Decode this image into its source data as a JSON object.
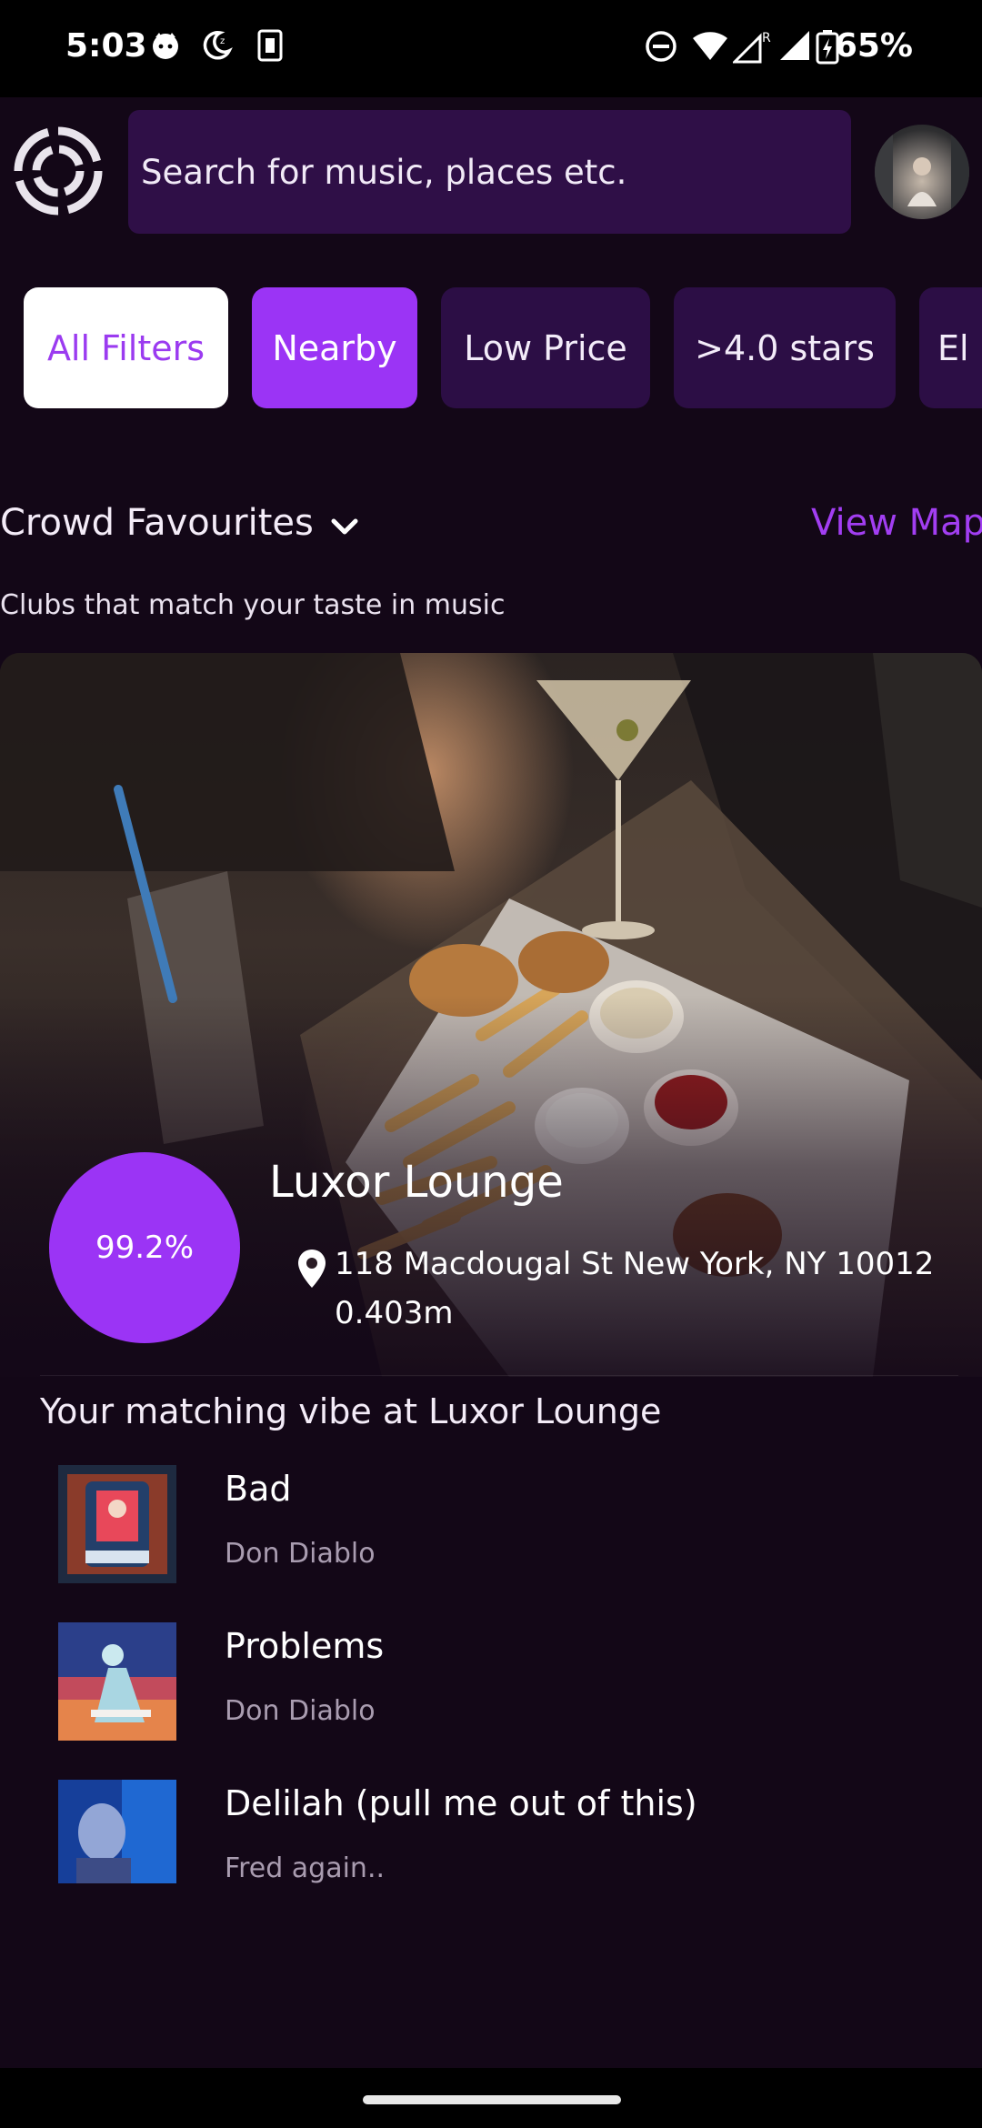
{
  "status_bar": {
    "time": "5:03",
    "battery": "65%",
    "icons": [
      "github-icon",
      "night-mode-icon",
      "sim-card-icon",
      "dnd-icon",
      "wifi-icon",
      "signal-roaming-icon",
      "signal-icon",
      "battery-charging-icon"
    ]
  },
  "header": {
    "logo_icon": "app-logo-icon",
    "search_placeholder": "Search for music, places etc.",
    "avatar_icon": "profile-avatar"
  },
  "filters": [
    {
      "label": "All Filters",
      "state": "outlined"
    },
    {
      "label": "Nearby",
      "state": "active"
    },
    {
      "label": "Low Price",
      "state": "inactive"
    },
    {
      "label": ">4.0 stars",
      "state": "inactive"
    },
    {
      "label": "El",
      "state": "inactive"
    }
  ],
  "section": {
    "title": "Crowd Favourites",
    "view_map": "View Map",
    "subtitle": "Clubs that match your taste in music"
  },
  "venue": {
    "match": "99.2%",
    "name": "Luxor Lounge",
    "address": "118 Macdougal St New York, NY 10012",
    "distance": "0.403m"
  },
  "vibe": {
    "title": "Your matching vibe at Luxor Lounge",
    "tracks": [
      {
        "title": "Bad",
        "artist": "Don Diablo"
      },
      {
        "title": "Problems",
        "artist": "Don Diablo"
      },
      {
        "title": "Delilah (pull me out of this)",
        "artist": "Fred again.."
      }
    ]
  },
  "colors": {
    "background": "#130717",
    "accent": "#9b34f5",
    "chip_bg": "#2c0e45",
    "search_bg": "#2f0f47",
    "view_map": "#a23ef2"
  }
}
